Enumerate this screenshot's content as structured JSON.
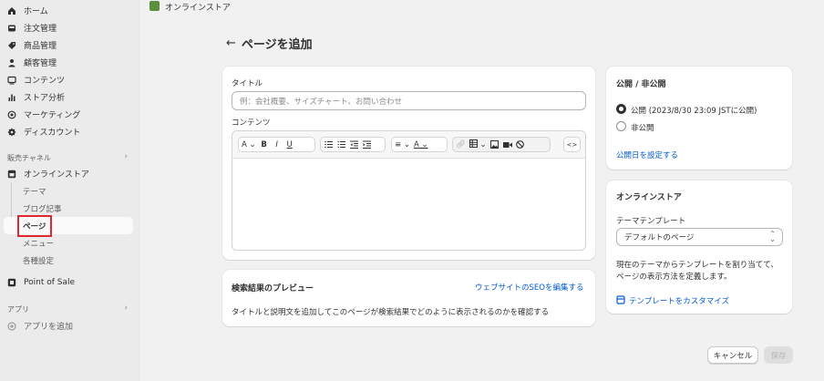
{
  "sidebar": {
    "items": [
      {
        "label": "ホーム",
        "icon": "home-icon"
      },
      {
        "label": "注文管理",
        "icon": "inbox-icon"
      },
      {
        "label": "商品管理",
        "icon": "tag-icon"
      },
      {
        "label": "顧客管理",
        "icon": "person-icon"
      },
      {
        "label": "コンテンツ",
        "icon": "content-icon"
      },
      {
        "label": "ストア分析",
        "icon": "bar-chart-icon"
      },
      {
        "label": "マーケティング",
        "icon": "target-icon"
      },
      {
        "label": "ディスカウント",
        "icon": "discount-icon"
      }
    ],
    "sales_channels_title": "販売チャネル",
    "online_store": "オンラインストア",
    "sub_items": [
      "テーマ",
      "ブログ記事",
      "ページ",
      "メニュー",
      "各種設定"
    ],
    "point_of_sale": "Point of Sale",
    "apps_title": "アプリ",
    "add_app": "アプリを追加"
  },
  "topbar": {
    "store_name": "オンラインストア"
  },
  "page": {
    "title": "ページを追加"
  },
  "main_card": {
    "title_label": "タイトル",
    "title_placeholder": "例：会社概要、サイズチャート、お問い合わせ",
    "content_label": "コンテンツ",
    "toolbar": {
      "text_style": "A",
      "bold": "B",
      "italic": "I",
      "underline": "U",
      "align": "≡",
      "color": "A",
      "code": "<>"
    }
  },
  "seo_card": {
    "title": "検索結果のプレビュー",
    "edit_link": "ウェブサイトのSEOを編集する",
    "description": "タイトルと説明文を追加してこのページが検索結果でどのように表示されるのかを確認する"
  },
  "visibility_card": {
    "title": "公開 / 非公開",
    "options": [
      "公開 (2023/8/30 23:09 JSTに公開)",
      "非公開"
    ],
    "selected": 0,
    "set_date_link": "公開日を設定する"
  },
  "online_store_card": {
    "title": "オンラインストア",
    "template_label": "テーマテンプレート",
    "template_value": "デフォルトのページ",
    "description": "現在のテーマからテンプレートを割り当てて、ページの表示方法を定義します。",
    "customize_link": "テンプレートをカスタマイズ"
  },
  "actions": {
    "cancel": "キャンセル",
    "save": "保存"
  }
}
